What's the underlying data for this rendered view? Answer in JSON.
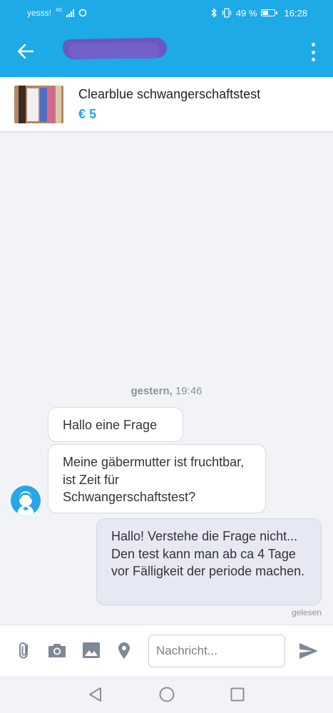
{
  "status_bar": {
    "carrier": "yesss!",
    "network": "4G",
    "battery": "49 %",
    "battery_level": 0.49,
    "time": "16:28"
  },
  "app_bar": {
    "back_icon": "arrow-left-icon",
    "menu_icon": "more-vertical-icon",
    "contact_name_redacted": true
  },
  "listing": {
    "title": "Clearblue schwangerschaftstest",
    "price": "€ 5"
  },
  "chat": {
    "date_day": "gestern,",
    "date_time": "19:46",
    "messages": [
      {
        "from": "other",
        "text": "Hallo eine Frage"
      },
      {
        "from": "other",
        "text": "Meine gäbermutter ist fruchtbar, ist Zeit für Schwangerschaftstest?"
      },
      {
        "from": "me",
        "text": "Hallo! Verstehe die Frage nicht... Den test kann man ab ca 4 Tage vor Fälligkeit der periode machen."
      }
    ],
    "read_status": "gelesen"
  },
  "input_bar": {
    "placeholder": "Nachricht...",
    "icons": [
      "attachment-icon",
      "camera-icon",
      "gallery-icon",
      "location-icon",
      "send-icon"
    ]
  },
  "nav_bar": {
    "icons": [
      "back-triangle-icon",
      "home-circle-icon",
      "recents-square-icon"
    ]
  },
  "colors": {
    "accent": "#1ea9e7",
    "redaction": "#6b56c2",
    "own_bubble": "#e6e9f4",
    "background": "#f2f3f7"
  }
}
